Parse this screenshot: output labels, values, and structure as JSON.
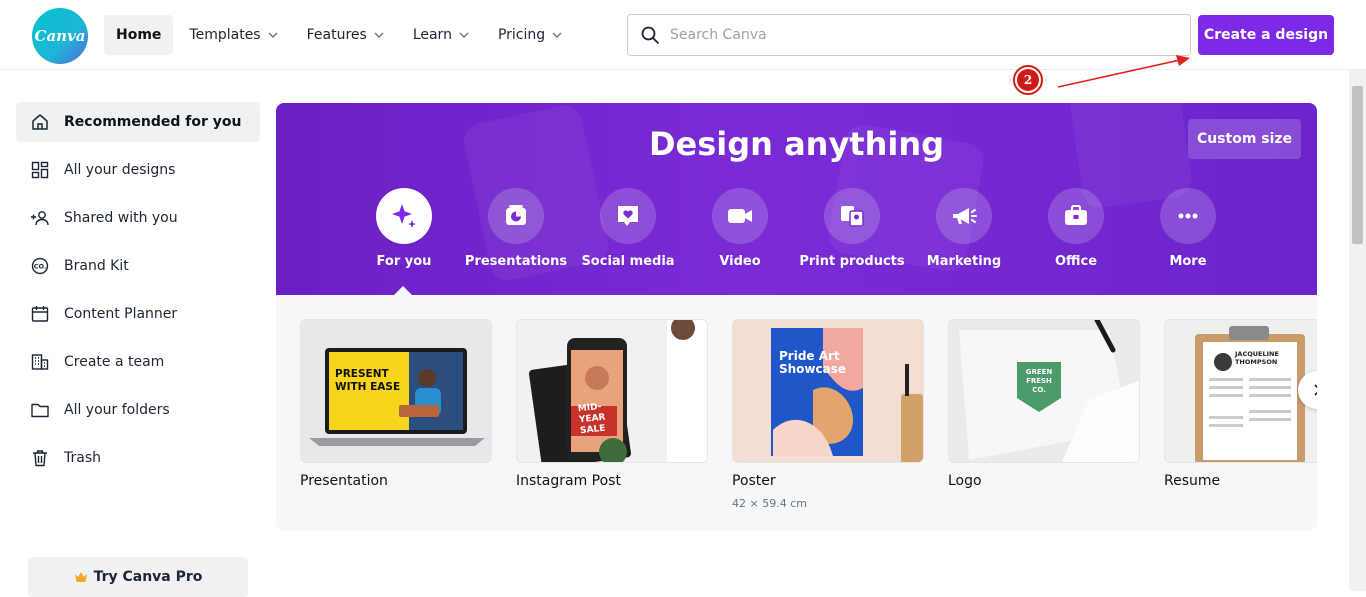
{
  "header": {
    "logo_text": "Canva",
    "nav": [
      {
        "label": "Home",
        "dropdown": false
      },
      {
        "label": "Templates",
        "dropdown": true
      },
      {
        "label": "Features",
        "dropdown": true
      },
      {
        "label": "Learn",
        "dropdown": true
      },
      {
        "label": "Pricing",
        "dropdown": true
      }
    ],
    "search_placeholder": "Search Canva",
    "create_label": "Create a design"
  },
  "annotation": {
    "step": "2",
    "color": "#d11a1a"
  },
  "sidebar": {
    "items": [
      {
        "label": "Recommended for you",
        "icon": "home-icon"
      },
      {
        "label": "All your designs",
        "icon": "grid-icon"
      },
      {
        "label": "Shared with you",
        "icon": "people-icon"
      },
      {
        "label": "Brand Kit",
        "icon": "brand-icon"
      },
      {
        "label": "Content Planner",
        "icon": "calendar-icon"
      },
      {
        "label": "Create a team",
        "icon": "building-icon"
      },
      {
        "label": "All your folders",
        "icon": "folder-icon"
      },
      {
        "label": "Trash",
        "icon": "trash-icon"
      }
    ],
    "pro_label": "Try Canva Pro"
  },
  "banner": {
    "title": "Design anything",
    "custom_size": "Custom size",
    "categories": [
      {
        "label": "For you",
        "icon": "sparkle-icon"
      },
      {
        "label": "Presentations",
        "icon": "presentation-icon"
      },
      {
        "label": "Social media",
        "icon": "heart-chat-icon"
      },
      {
        "label": "Video",
        "icon": "video-icon"
      },
      {
        "label": "Print products",
        "icon": "print-icon"
      },
      {
        "label": "Marketing",
        "icon": "megaphone-icon"
      },
      {
        "label": "Office",
        "icon": "briefcase-icon"
      },
      {
        "label": "More",
        "icon": "more-icon"
      }
    ]
  },
  "templates": [
    {
      "title": "Presentation",
      "thumb_text": "PRESENT WITH EASE"
    },
    {
      "title": "Instagram Post",
      "thumb_text": "MID-YEAR SALE"
    },
    {
      "title": "Poster",
      "sub": "42 × 59.4 cm",
      "thumb_text": "Pride Art Showcase"
    },
    {
      "title": "Logo",
      "thumb_text": "GREEN FRESH CO."
    },
    {
      "title": "Resume",
      "thumb_text": "JACQUELINE THOMPSON"
    }
  ],
  "colors": {
    "accent": "#7d2ae8",
    "banner": "#6a1fc4",
    "logo": "#00c4cc"
  }
}
